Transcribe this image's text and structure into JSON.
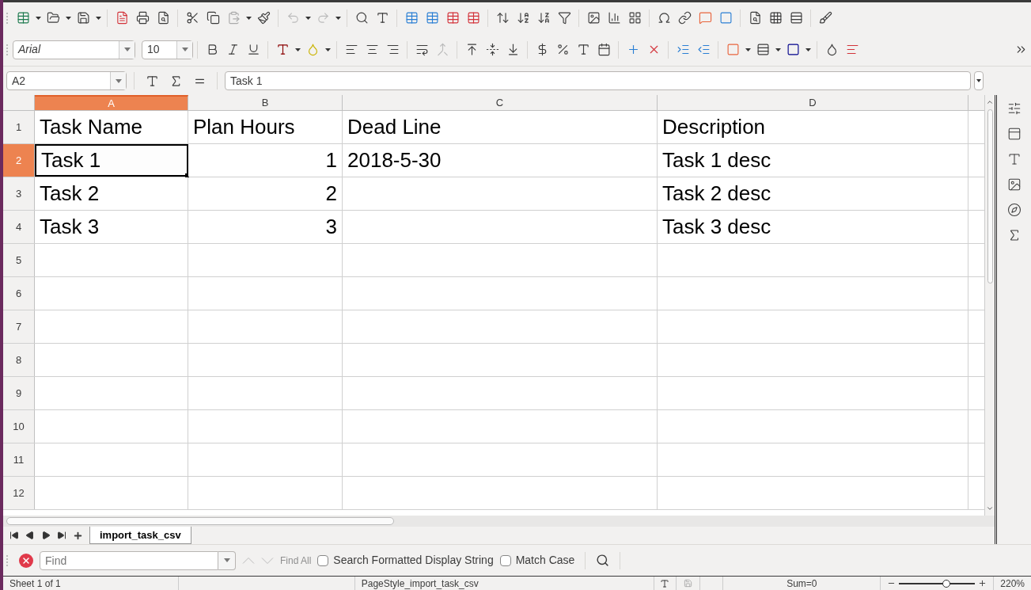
{
  "font_name": {
    "value": "Arial"
  },
  "font_size": {
    "value": "10"
  },
  "name_box": {
    "value": "A2"
  },
  "formula": {
    "value": "Task 1"
  },
  "columns": [
    {
      "label": "A",
      "selected": true
    },
    {
      "label": "B",
      "selected": false
    },
    {
      "label": "C",
      "selected": false
    },
    {
      "label": "D",
      "selected": false
    }
  ],
  "rows": [
    {
      "number": "1",
      "selected": false,
      "cells": [
        {
          "text": "Task Name",
          "kind": "text",
          "selected": false
        },
        {
          "text": "Plan Hours",
          "kind": "text",
          "selected": false
        },
        {
          "text": "Dead Line",
          "kind": "text",
          "selected": false
        },
        {
          "text": "Description",
          "kind": "text",
          "selected": false
        }
      ]
    },
    {
      "number": "2",
      "selected": true,
      "cells": [
        {
          "text": "Task 1",
          "kind": "text",
          "selected": true
        },
        {
          "text": "1",
          "kind": "number",
          "selected": false
        },
        {
          "text": "2018-5-30",
          "kind": "text",
          "selected": false
        },
        {
          "text": "Task 1 desc",
          "kind": "text",
          "selected": false
        }
      ]
    },
    {
      "number": "3",
      "selected": false,
      "cells": [
        {
          "text": "Task 2",
          "kind": "text",
          "selected": false
        },
        {
          "text": "2",
          "kind": "number",
          "selected": false
        },
        {
          "text": "",
          "kind": "text",
          "selected": false
        },
        {
          "text": "Task 2 desc",
          "kind": "text",
          "selected": false
        }
      ]
    },
    {
      "number": "4",
      "selected": false,
      "cells": [
        {
          "text": "Task 3",
          "kind": "text",
          "selected": false
        },
        {
          "text": "3",
          "kind": "number",
          "selected": false
        },
        {
          "text": "",
          "kind": "text",
          "selected": false
        },
        {
          "text": "Task 3 desc",
          "kind": "text",
          "selected": false
        }
      ]
    },
    {
      "number": "5",
      "selected": false,
      "cells": []
    },
    {
      "number": "6",
      "selected": false,
      "cells": []
    },
    {
      "number": "7",
      "selected": false,
      "cells": []
    },
    {
      "number": "8",
      "selected": false,
      "cells": []
    },
    {
      "number": "9",
      "selected": false,
      "cells": []
    },
    {
      "number": "10",
      "selected": false,
      "cells": []
    },
    {
      "number": "11",
      "selected": false,
      "cells": []
    },
    {
      "number": "12",
      "selected": false,
      "cells": []
    }
  ],
  "sheet_tabs": [
    {
      "label": "import_task_csv",
      "selected": true
    }
  ],
  "find_bar": {
    "placeholder": "Find",
    "find_all": {
      "label": "Find All",
      "disabled": true
    },
    "options": [
      {
        "label": "Search Formatted Display String",
        "checked": false
      },
      {
        "label": "Match Case",
        "checked": false
      }
    ]
  },
  "status_bar": {
    "sheet": "Sheet 1 of 1",
    "page_style": "PageStyle_import_task_csv",
    "sum": "Sum=0",
    "zoom": "220%",
    "zoom_slider": {
      "level": 0.62
    }
  }
}
